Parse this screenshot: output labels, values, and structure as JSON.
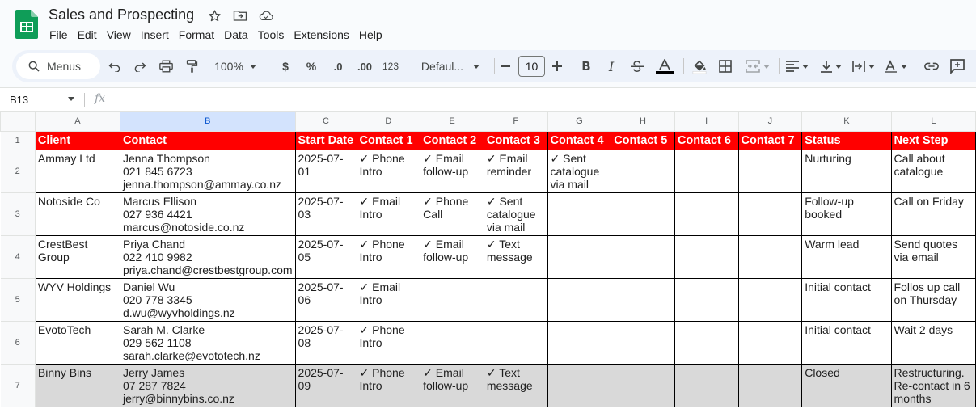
{
  "app": {
    "doc_title": "Sales and Prospecting",
    "menu": [
      "File",
      "Edit",
      "View",
      "Insert",
      "Format",
      "Data",
      "Tools",
      "Extensions",
      "Help"
    ]
  },
  "toolbar": {
    "search_label": "Menus",
    "zoom": "100%",
    "currency": "$",
    "percent": "%",
    "dec_decrease": ".0",
    "dec_increase": ".00",
    "number_format": "123",
    "font": "Defaul...",
    "font_size": "10",
    "text_color_underline": "#000000"
  },
  "formula_bar": {
    "cell_ref": "B13",
    "fx": "fx",
    "value": ""
  },
  "sheet": {
    "columns": [
      "A",
      "B",
      "C",
      "D",
      "E",
      "F",
      "G",
      "H",
      "I",
      "J",
      "K",
      "L"
    ],
    "selected_column": "B",
    "header_bg": "#ff0000",
    "header_row": [
      "Client",
      "Contact",
      "Start Date",
      "Contact 1",
      "Contact 2",
      "Contact 3",
      "Contact 4",
      "Contact 5",
      "Contact 6",
      "Contact 7",
      "Status",
      "Next Step"
    ],
    "rows": [
      {
        "num": "2",
        "grey": false,
        "cells": [
          "Ammay Ltd",
          "Jenna Thompson\n021 845 6723\njenna.thompson@ammay.co.nz",
          "2025-07-01",
          "✓ Phone\nIntro",
          "✓ Email\nfollow-up",
          "✓ Email\nreminder",
          "✓ Sent\ncatalogue\nvia mail",
          "",
          "",
          "",
          "Nurturing",
          "Call about\ncatalogue"
        ]
      },
      {
        "num": "3",
        "grey": false,
        "cells": [
          "Notoside Co",
          "Marcus Ellison\n027 936 4421\nmarcus@notoside.co.nz",
          "2025-07-03",
          "✓ Email\nIntro",
          "✓ Phone\nCall",
          "✓ Sent\ncatalogue\nvia mail",
          "",
          "",
          "",
          "",
          "Follow-up booked",
          "Call on Friday"
        ]
      },
      {
        "num": "4",
        "grey": false,
        "cells": [
          "CrestBest Group",
          "Priya Chand\n022 410 9982\npriya.chand@crestbestgroup.com",
          "2025-07-05",
          "✓ Phone\nIntro",
          "✓ Email\nfollow-up",
          "✓ Text\nmessage",
          "",
          "",
          "",
          "",
          "Warm lead",
          "Send quotes\nvia email"
        ]
      },
      {
        "num": "5",
        "grey": false,
        "cells": [
          "WYV Holdings",
          "Daniel Wu\n020 778 3345\nd.wu@wyvholdings.nz",
          "2025-07-06",
          "✓ Email\nIntro",
          "",
          "",
          "",
          "",
          "",
          "",
          "Initial contact",
          "Follos up call\non Thursday"
        ]
      },
      {
        "num": "6",
        "grey": false,
        "cells": [
          "EvotoTech",
          "Sarah M. Clarke\n029 562 1108\nsarah.clarke@evototech.nz",
          "2025-07-08",
          "✓ Phone\nIntro",
          "",
          "",
          "",
          "",
          "",
          "",
          "Initial contact",
          "Wait 2 days"
        ]
      },
      {
        "num": "7",
        "grey": true,
        "cells": [
          "Binny Bins",
          "Jerry James\n07 287 7824\njerry@binnybins.co.nz",
          "2025-07-09",
          "✓ Phone\nIntro",
          "✓ Email\nfollow-up",
          "✓ Text\nmessage",
          "",
          "",
          "",
          "",
          "Closed",
          "Restructuring.\nRe-contact in 6\nmonths"
        ]
      }
    ]
  }
}
